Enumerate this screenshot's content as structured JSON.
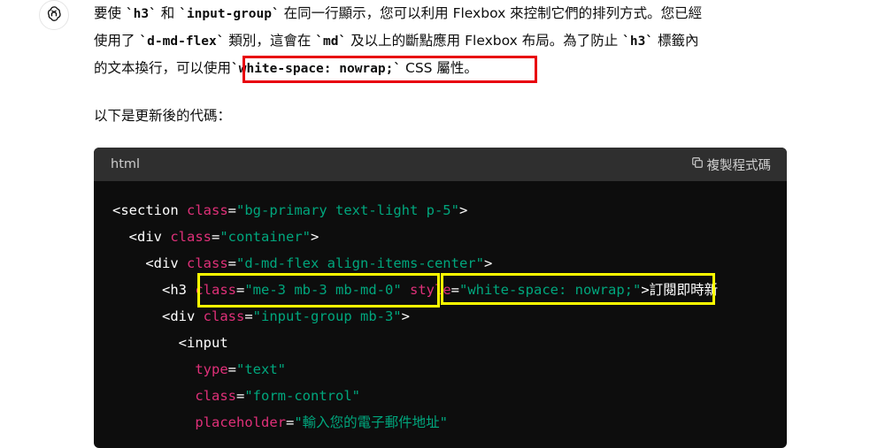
{
  "assistant": {
    "avatar_icon": "openai-logo-icon",
    "paragraph1": {
      "line1": [
        {
          "t": "text",
          "v": "要使 "
        },
        {
          "t": "code",
          "v": "`h3`"
        },
        {
          "t": "text",
          "v": " 和 "
        },
        {
          "t": "code",
          "v": "`input-group`"
        },
        {
          "t": "text",
          "v": " 在同一行顯示，您可以利用 Flexbox 來控制它們的排列方式。您已經"
        }
      ],
      "line2": [
        {
          "t": "text",
          "v": "使用了 "
        },
        {
          "t": "code",
          "v": "`d-md-flex`"
        },
        {
          "t": "text",
          "v": " 類別，這會在 "
        },
        {
          "t": "code",
          "v": "`md`"
        },
        {
          "t": "text",
          "v": " 及以上的斷點應用 Flexbox 布局。為了防止 "
        },
        {
          "t": "code",
          "v": "`h3`"
        },
        {
          "t": "text",
          "v": " 標籤內"
        }
      ],
      "line3_prefix": "的文本換行，可以使用",
      "line3_code": "`white-space: nowrap;`",
      "line3_suffix": " CSS 屬性。"
    },
    "paragraph2": "以下是更新後的代碼："
  },
  "code_block": {
    "language": "html",
    "copy_label": "複製程式碼",
    "copy_icon": "copy-icon",
    "lines": [
      [
        {
          "c": "tag",
          "v": "<section "
        },
        {
          "c": "attr",
          "v": "class"
        },
        {
          "c": "tag",
          "v": "="
        },
        {
          "c": "str",
          "v": "\"bg-primary text-light p-5\""
        },
        {
          "c": "tag",
          "v": ">"
        }
      ],
      [
        {
          "c": "tag",
          "v": "  <div "
        },
        {
          "c": "attr",
          "v": "class"
        },
        {
          "c": "tag",
          "v": "="
        },
        {
          "c": "str",
          "v": "\"container\""
        },
        {
          "c": "tag",
          "v": ">"
        }
      ],
      [
        {
          "c": "tag",
          "v": "    <div "
        },
        {
          "c": "attr",
          "v": "class"
        },
        {
          "c": "tag",
          "v": "="
        },
        {
          "c": "str",
          "v": "\"d-md-flex align-items-center\""
        },
        {
          "c": "tag",
          "v": ">"
        }
      ],
      [
        {
          "c": "tag",
          "v": "      <h3 "
        },
        {
          "c": "attr",
          "v": "class"
        },
        {
          "c": "tag",
          "v": "="
        },
        {
          "c": "str",
          "v": "\"me-3 mb-3 mb-md-0\""
        },
        {
          "c": "tag",
          "v": " "
        },
        {
          "c": "attr",
          "v": "style"
        },
        {
          "c": "tag",
          "v": "="
        },
        {
          "c": "str",
          "v": "\"white-space: nowrap;\""
        },
        {
          "c": "tag",
          "v": ">訂閱即時新"
        }
      ],
      [
        {
          "c": "tag",
          "v": "      <div "
        },
        {
          "c": "attr",
          "v": "class"
        },
        {
          "c": "tag",
          "v": "="
        },
        {
          "c": "str",
          "v": "\"input-group mb-3\""
        },
        {
          "c": "tag",
          "v": ">"
        }
      ],
      [
        {
          "c": "tag",
          "v": "        <input"
        }
      ],
      [
        {
          "c": "tag",
          "v": "          "
        },
        {
          "c": "attr",
          "v": "type"
        },
        {
          "c": "tag",
          "v": "="
        },
        {
          "c": "str",
          "v": "\"text\""
        }
      ],
      [
        {
          "c": "tag",
          "v": "          "
        },
        {
          "c": "attr",
          "v": "class"
        },
        {
          "c": "tag",
          "v": "="
        },
        {
          "c": "str",
          "v": "\"form-control\""
        }
      ],
      [
        {
          "c": "tag",
          "v": "          "
        },
        {
          "c": "attr",
          "v": "placeholder"
        },
        {
          "c": "tag",
          "v": "="
        },
        {
          "c": "str",
          "v": "\"輸入您的電子郵件地址\""
        }
      ]
    ]
  },
  "annotations": {
    "red_box_color": "#e8000b",
    "yellow_box_color": "#ffff00"
  }
}
